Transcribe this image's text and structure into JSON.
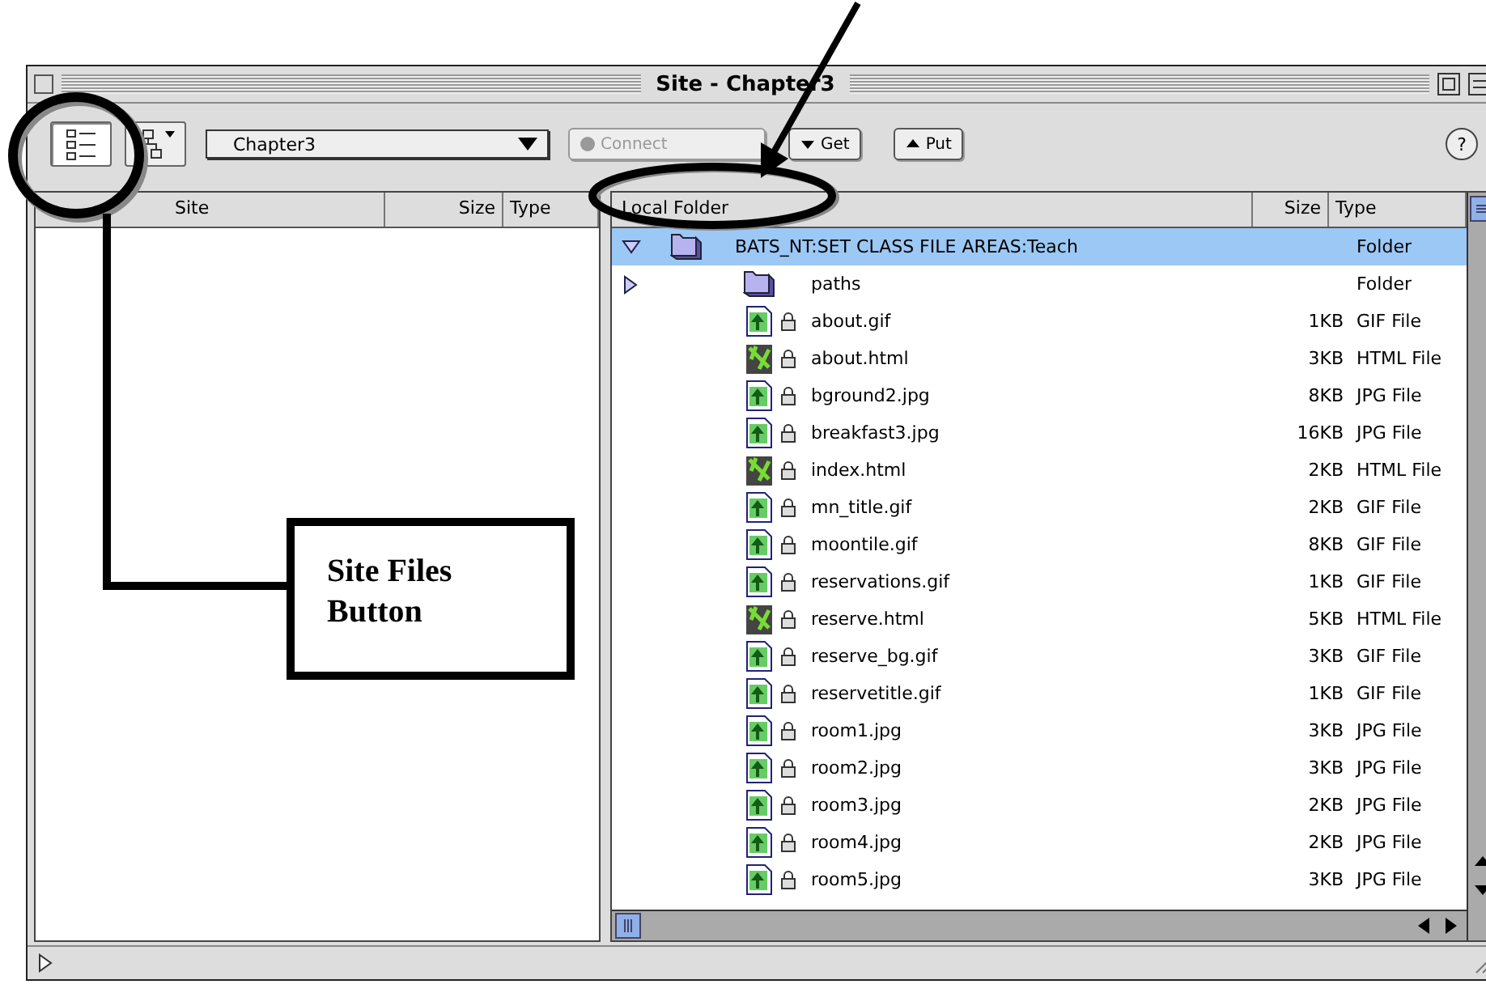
{
  "window": {
    "title": "Site - Chapter3"
  },
  "toolbar": {
    "site_files_pressed": true,
    "site": "Chapter3",
    "buttons": [
      {
        "label": "Connect",
        "disabled": true,
        "kind": "connect"
      },
      {
        "label": "Get",
        "disabled": false,
        "kind": "get"
      },
      {
        "label": "Put",
        "disabled": false,
        "kind": "put"
      }
    ],
    "help": "?"
  },
  "remote_pane": {
    "columns": [
      "Site",
      "Size",
      "Type"
    ]
  },
  "local_pane": {
    "columns": [
      "Local Folder",
      "Size",
      "Type"
    ],
    "tree": [
      {
        "name": "BATS_NT:SET CLASS FILE AREAS:Teach",
        "type": "Folder",
        "kind": "folder",
        "expanded": true,
        "selected": true,
        "children": [
          {
            "name": "paths",
            "type": "Folder",
            "kind": "folder",
            "expanded": false,
            "selected": false
          },
          {
            "name": "about.gif",
            "size": "1KB",
            "type": "GIF File",
            "kind": "image",
            "selected": false
          },
          {
            "name": "about.html",
            "size": "3KB",
            "type": "HTML File",
            "kind": "html",
            "selected": false
          },
          {
            "name": "bground2.jpg",
            "size": "8KB",
            "type": "JPG File",
            "kind": "image",
            "selected": false
          },
          {
            "name": "breakfast3.jpg",
            "size": "16KB",
            "type": "JPG File",
            "kind": "image",
            "selected": false
          },
          {
            "name": "index.html",
            "size": "2KB",
            "type": "HTML File",
            "kind": "html",
            "selected": false
          },
          {
            "name": "mn_title.gif",
            "size": "2KB",
            "type": "GIF File",
            "kind": "image",
            "selected": false
          },
          {
            "name": "moontile.gif",
            "size": "8KB",
            "type": "GIF File",
            "kind": "image",
            "selected": false
          },
          {
            "name": "reservations.gif",
            "size": "1KB",
            "type": "GIF File",
            "kind": "image",
            "selected": false
          },
          {
            "name": "reserve.html",
            "size": "5KB",
            "type": "HTML File",
            "kind": "html",
            "selected": false
          },
          {
            "name": "reserve_bg.gif",
            "size": "3KB",
            "type": "GIF File",
            "kind": "image",
            "selected": false
          },
          {
            "name": "reservetitle.gif",
            "size": "1KB",
            "type": "GIF File",
            "kind": "image",
            "selected": false
          },
          {
            "name": "room1.jpg",
            "size": "3KB",
            "type": "JPG File",
            "kind": "image",
            "selected": false
          },
          {
            "name": "room2.jpg",
            "size": "3KB",
            "type": "JPG File",
            "kind": "image",
            "selected": false
          },
          {
            "name": "room3.jpg",
            "size": "2KB",
            "type": "JPG File",
            "kind": "image",
            "selected": false
          },
          {
            "name": "room4.jpg",
            "size": "2KB",
            "type": "JPG File",
            "kind": "image",
            "selected": false
          },
          {
            "name": "room5.jpg",
            "size": "3KB",
            "type": "JPG File",
            "kind": "image",
            "selected": false
          }
        ]
      }
    ]
  },
  "annotation": {
    "label": "Site Files Button"
  }
}
